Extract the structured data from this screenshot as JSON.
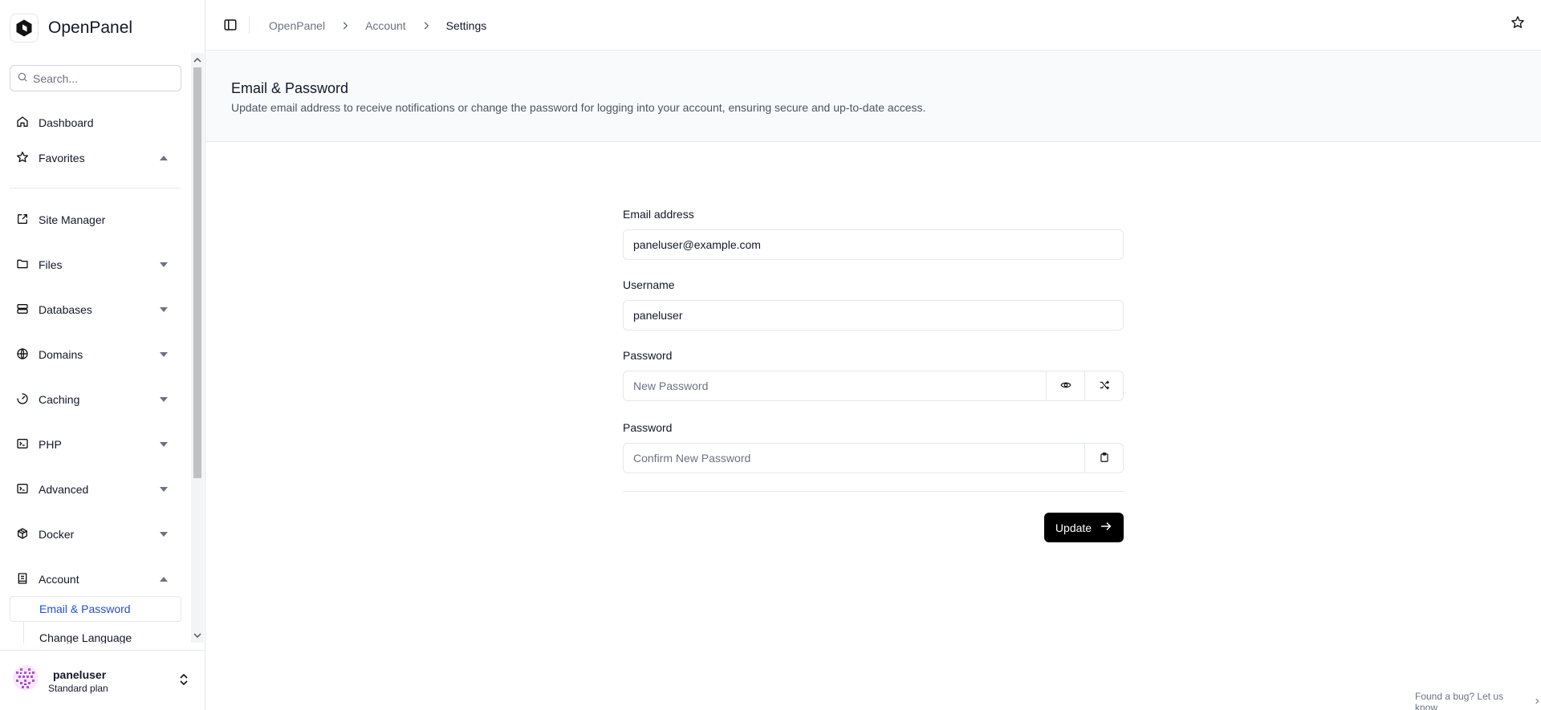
{
  "brand": {
    "name": "OpenPanel",
    "logo_icon": "openpanel-logo-icon"
  },
  "search": {
    "placeholder": "Search..."
  },
  "sidebar": {
    "items": [
      {
        "label": "Dashboard",
        "icon": "home-icon"
      },
      {
        "label": "Favorites",
        "icon": "star-icon",
        "expanded": true
      },
      {
        "label": "Site Manager",
        "icon": "external-link-icon"
      },
      {
        "label": "Files",
        "icon": "folder-icon",
        "expanded": false
      },
      {
        "label": "Databases",
        "icon": "database-icon",
        "expanded": false
      },
      {
        "label": "Domains",
        "icon": "globe-icon",
        "expanded": false
      },
      {
        "label": "Caching",
        "icon": "gauge-icon",
        "expanded": false
      },
      {
        "label": "PHP",
        "icon": "terminal-icon",
        "expanded": false
      },
      {
        "label": "Advanced",
        "icon": "terminal-icon",
        "expanded": false
      },
      {
        "label": "Docker",
        "icon": "package-icon",
        "expanded": false
      },
      {
        "label": "Account",
        "icon": "book-icon",
        "expanded": true
      }
    ],
    "account_sub": [
      {
        "label": "Email & Password",
        "active": true
      },
      {
        "label": "Change Language",
        "active": false
      }
    ]
  },
  "user": {
    "name": "paneluser",
    "plan": "Standard plan"
  },
  "breadcrumb": {
    "items": [
      "OpenPanel",
      "Account"
    ],
    "current": "Settings"
  },
  "header": {
    "title": "Email & Password",
    "description": "Update email address to receive notifications or change the password for logging into your account, ensuring secure and up-to-date access."
  },
  "form": {
    "email": {
      "label": "Email address",
      "value": "paneluser@example.com"
    },
    "username": {
      "label": "Username",
      "value": "paneluser"
    },
    "password": {
      "label": "Password",
      "placeholder": "New Password"
    },
    "confirm": {
      "label": "Password",
      "placeholder": "Confirm New Password"
    },
    "submit_label": "Update"
  },
  "footer": {
    "bug_link": "Found a bug? Let us know"
  },
  "colors": {
    "accent": "#1d4ed8",
    "primary_button": "#000000",
    "header_bg": "#f9fafb",
    "border": "#e5e7eb"
  }
}
